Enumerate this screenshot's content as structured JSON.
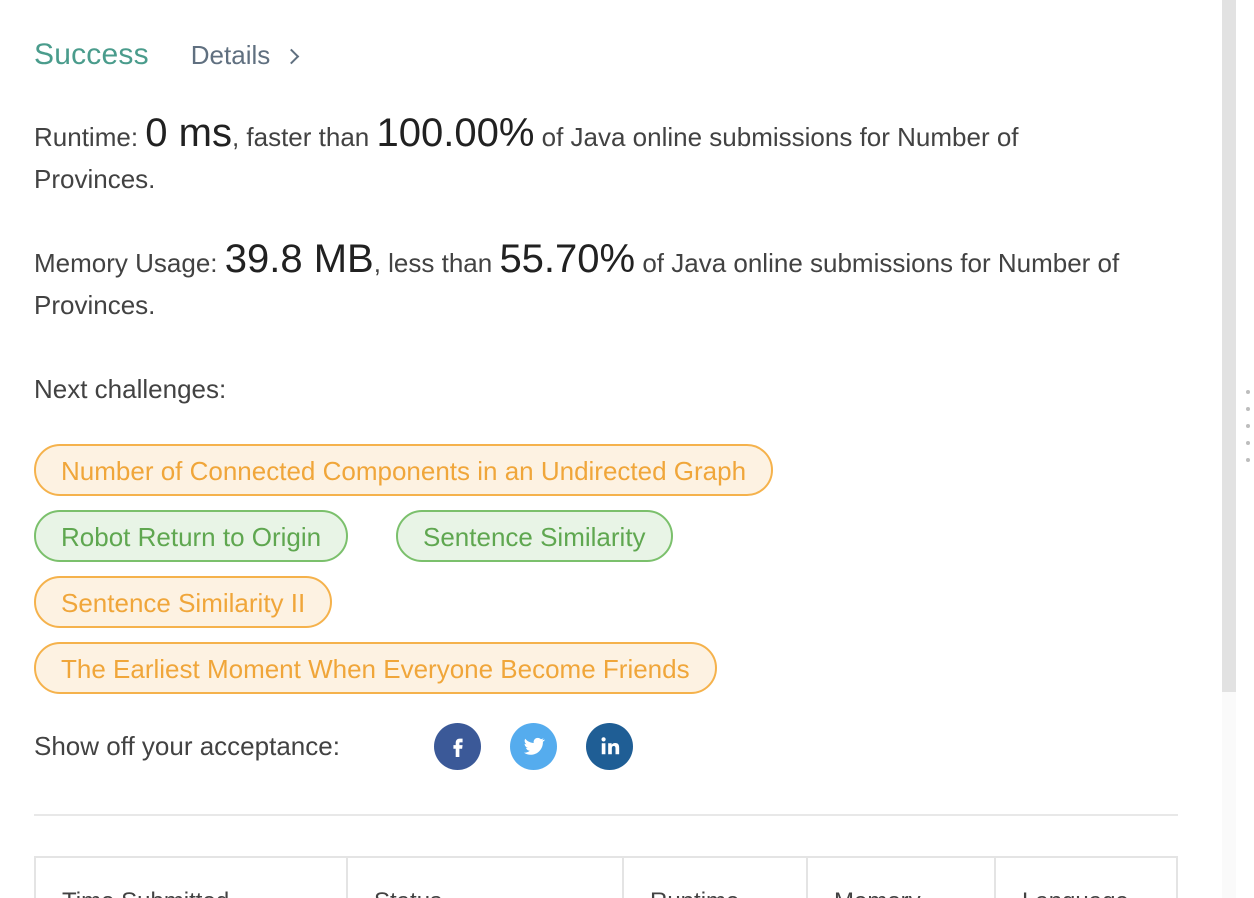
{
  "header": {
    "status": "Success",
    "details_label": "Details"
  },
  "runtime": {
    "label": "Runtime: ",
    "value": "0 ms",
    "connector": ", faster than ",
    "percent": "100.00%",
    "suffix": " of Java online submissions for Number of Provinces."
  },
  "memory": {
    "label": "Memory Usage: ",
    "value": "39.8 MB",
    "connector": ", less than ",
    "percent": "55.70%",
    "suffix": " of Java online submissions for Number of Provinces."
  },
  "next_challenges": {
    "label": "Next challenges:",
    "items": [
      {
        "title": "Number of Connected Components in an Undirected Graph",
        "difficulty": "medium"
      },
      {
        "title": "Robot Return to Origin",
        "difficulty": "easy"
      },
      {
        "title": "Sentence Similarity",
        "difficulty": "easy"
      },
      {
        "title": "Sentence Similarity II",
        "difficulty": "medium"
      },
      {
        "title": "The Earliest Moment When Everyone Become Friends",
        "difficulty": "medium"
      }
    ]
  },
  "share": {
    "label": "Show off your acceptance:",
    "buttons": [
      {
        "icon": "facebook-icon",
        "color": "#3b5998"
      },
      {
        "icon": "twitter-icon",
        "color": "#55acee"
      },
      {
        "icon": "linkedin-icon",
        "color": "#1f5e95"
      }
    ]
  },
  "colors": {
    "success": "#4a9c8c",
    "medium_border": "#f5b24c",
    "medium_text": "#f0a63a",
    "medium_bg": "#fdf2e2",
    "easy_border": "#7bc06c",
    "easy_text": "#5fa750",
    "easy_bg": "#e8f4e6"
  },
  "table": {
    "headers": [
      "Time Submitted",
      "Status",
      "Runtime",
      "Memory",
      "Language"
    ]
  }
}
